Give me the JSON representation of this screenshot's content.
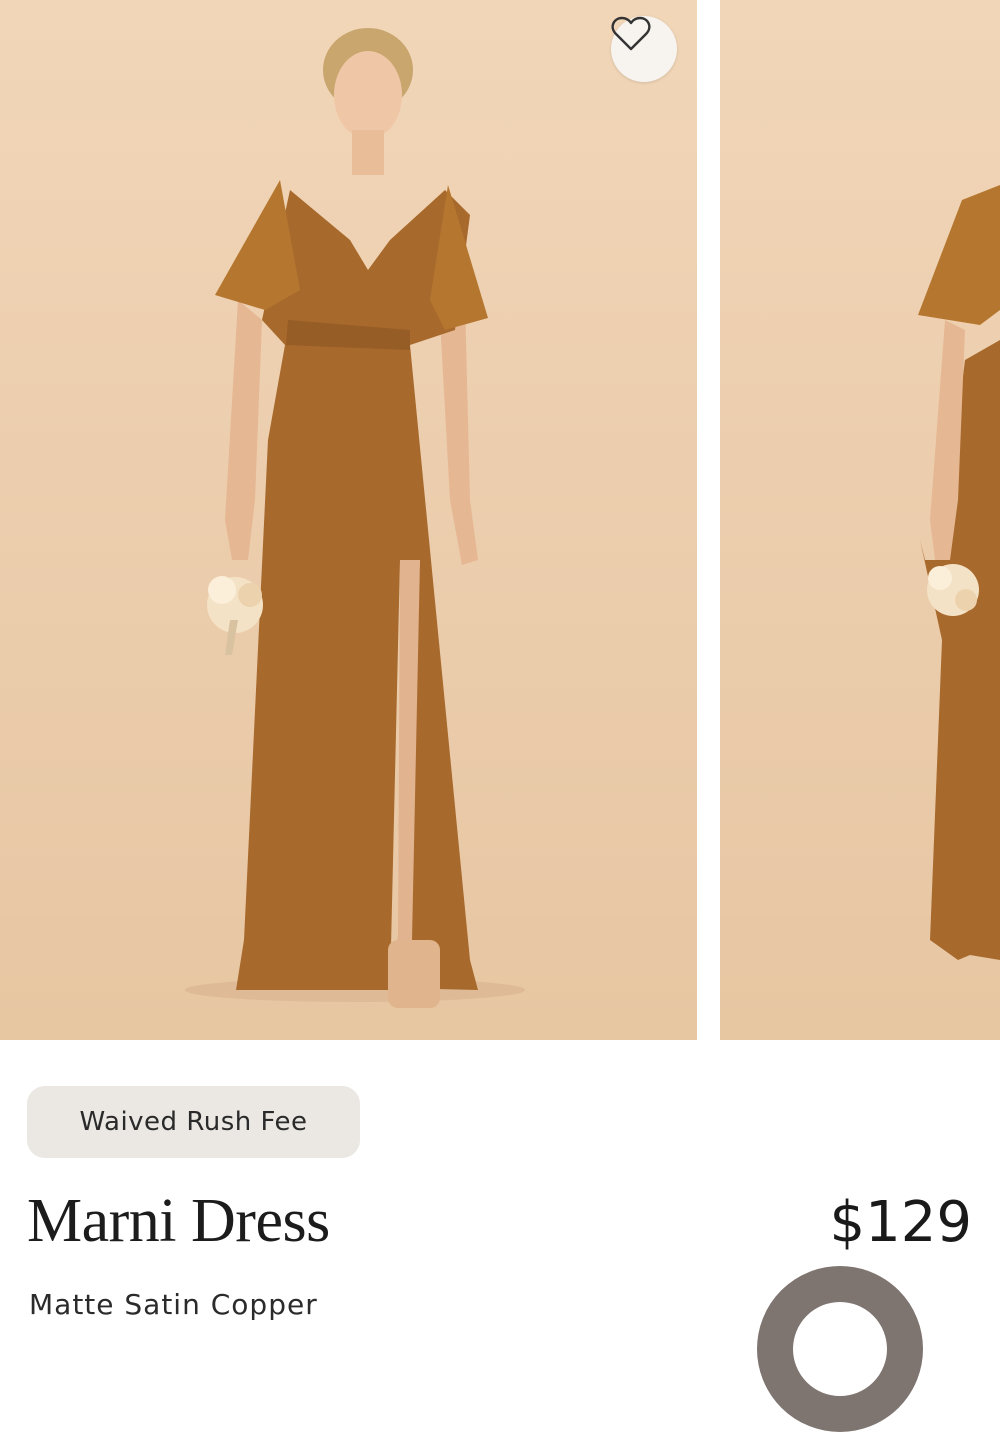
{
  "product": {
    "badge": "Waived Rush Fee",
    "name": "Marni Dress",
    "price": "$129",
    "color_name": "Matte Satin Copper"
  },
  "colors": {
    "backdrop": "#ecceae",
    "dress": "#a8692c",
    "swatch_ring": "#7e7470"
  },
  "icons": {
    "favorite": "heart-icon"
  }
}
